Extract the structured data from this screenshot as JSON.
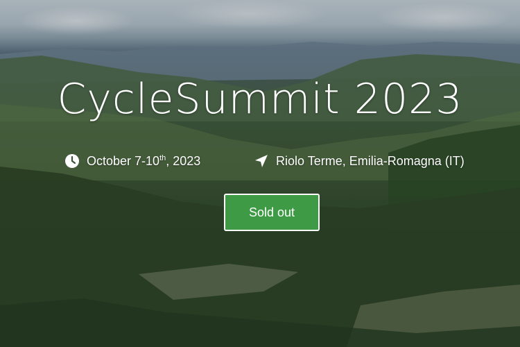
{
  "hero": {
    "title": "CycleSummit 2023",
    "date_main": "October 7-10",
    "date_sup": "th",
    "date_year": ", 2023",
    "location": "Riolo Terme, Emilia-Romagna (IT)",
    "button_label": "Sold out",
    "button_color": "#3f9a46",
    "icons": [
      "clock-icon",
      "location-arrow-icon"
    ]
  }
}
